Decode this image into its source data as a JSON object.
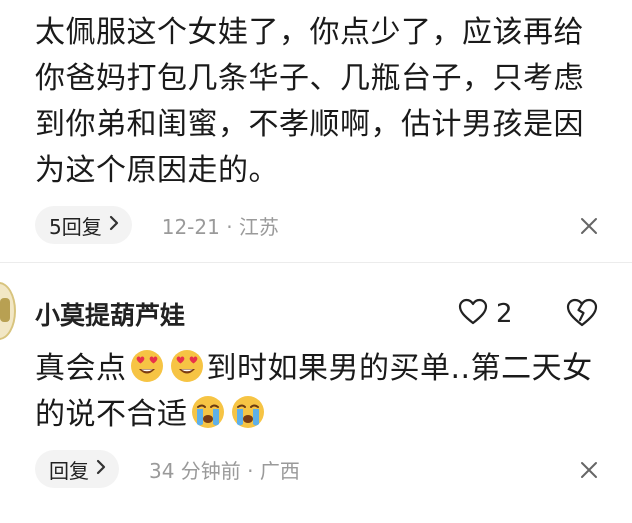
{
  "comment1": {
    "text": "太佩服这个女娃了，你点少了，应该再给你爸妈打包几条华子、几瓶台子，只考虑到你弟和闺蜜，不孝顺啊，估计男孩是因为这个原因走的。",
    "reply_label": "5回复",
    "meta": "12-21 · 江苏"
  },
  "comment2": {
    "username": "小莫提葫芦娃",
    "like_count": "2",
    "text_part1": "真会点",
    "text_part2": "到时如果男的买单..第二天女的说不合适",
    "reply_label": "回复",
    "meta": "34 分钟前 · 广西"
  },
  "icons": {
    "reply_chevron": "chevron-right-icon",
    "close": "close-icon",
    "like": "heart-outline-icon",
    "dislike": "broken-heart-icon",
    "emoji_heart_eyes": "heart-eyes-emoji-icon",
    "emoji_crying": "loudly-crying-emoji-icon"
  },
  "colors": {
    "text": "#1a1a1a",
    "meta": "#9a9a9a",
    "pill_bg": "#f3f3f3",
    "emoji_face": "#f6c444",
    "emoji_heart": "#e8324a",
    "emoji_tear": "#5fb0e8"
  }
}
